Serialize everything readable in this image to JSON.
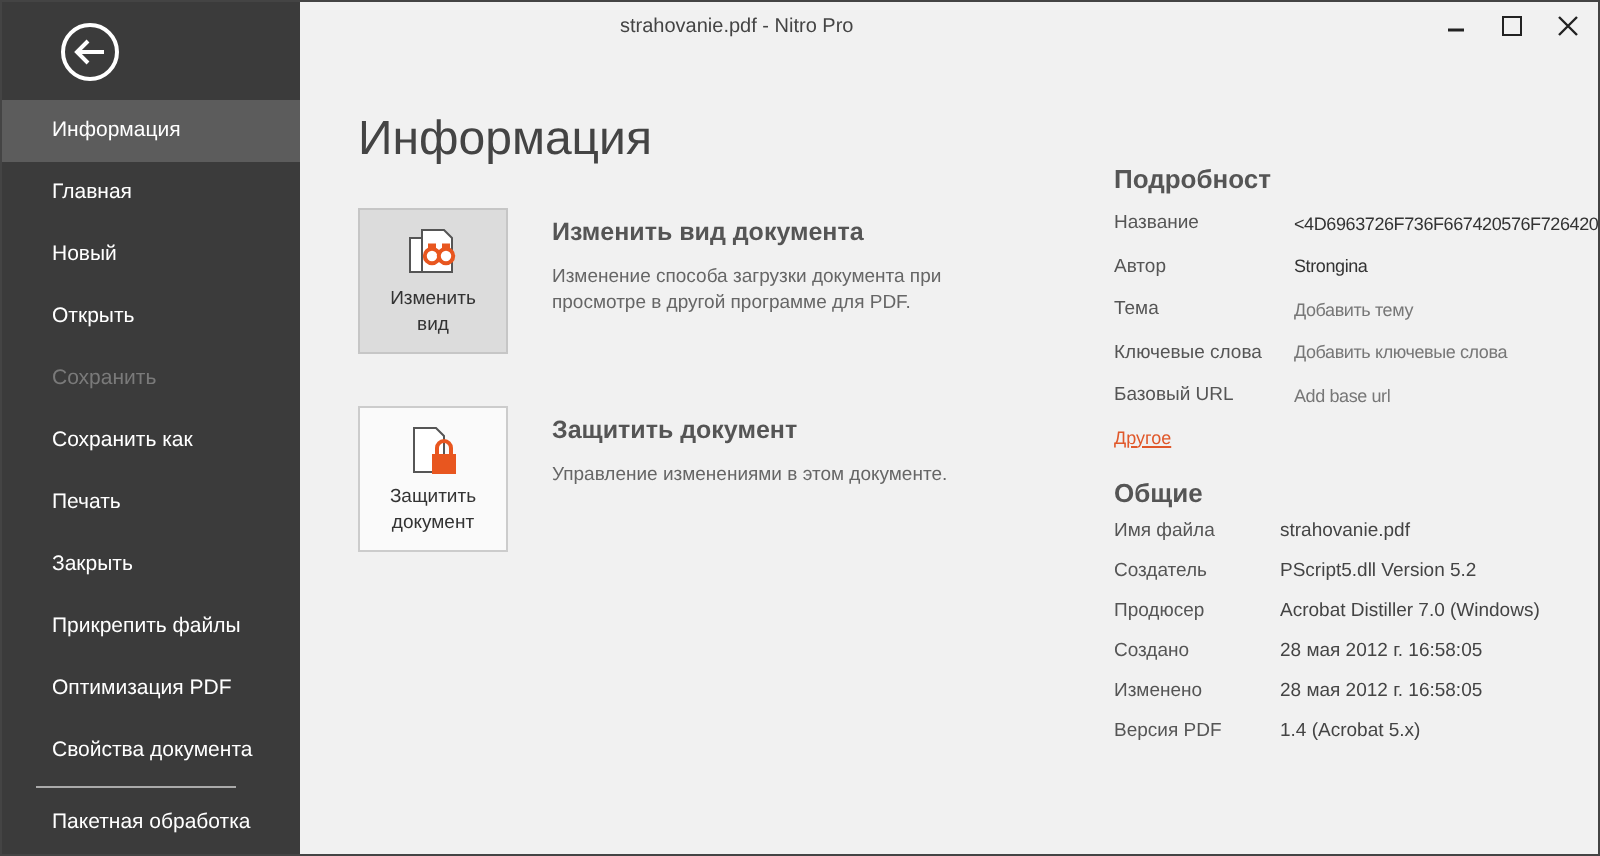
{
  "window": {
    "title": "strahovanie.pdf - Nitro Pro"
  },
  "sidebar": {
    "items": [
      {
        "label": "Информация",
        "selected": true,
        "disabled": false
      },
      {
        "label": "Главная",
        "selected": false,
        "disabled": false
      },
      {
        "label": "Новый",
        "selected": false,
        "disabled": false
      },
      {
        "label": "Открыть",
        "selected": false,
        "disabled": false
      },
      {
        "label": "Сохранить",
        "selected": false,
        "disabled": true
      },
      {
        "label": "Сохранить как",
        "selected": false,
        "disabled": false
      },
      {
        "label": "Печать",
        "selected": false,
        "disabled": false
      },
      {
        "label": "Закрыть",
        "selected": false,
        "disabled": false
      },
      {
        "label": "Прикрепить файлы",
        "selected": false,
        "disabled": false
      },
      {
        "label": "Оптимизация PDF",
        "selected": false,
        "disabled": false
      },
      {
        "label": "Свойства документа",
        "selected": false,
        "disabled": false
      }
    ],
    "footer_item": {
      "label": "Пакетная обработка",
      "selected": false,
      "disabled": false
    }
  },
  "page_title": "Информация",
  "actions": [
    {
      "kind": "view",
      "button": [
        "Изменить",
        "вид"
      ],
      "selected": true,
      "title": "Изменить вид документа",
      "description": "Изменение способа загрузки документа при просмотре в другой программе для PDF."
    },
    {
      "kind": "protect",
      "button": [
        "Защитить",
        "документ"
      ],
      "selected": false,
      "title": "Защитить документ",
      "description": "Управление изменениями в этом документе."
    }
  ],
  "details": {
    "heading": "Подробност",
    "rows": [
      {
        "label": "Название",
        "value": "<4D6963726F736F667420576F726420"
      },
      {
        "label": "Автор",
        "value": "Strongina"
      },
      {
        "label": "Тема",
        "placeholder": "Добавить тему"
      },
      {
        "label": "Ключевые слова",
        "placeholder": "Добавить ключевые слова"
      },
      {
        "label": "Базовый URL",
        "placeholder": "Add base url"
      }
    ],
    "link": "Другое"
  },
  "general": {
    "heading": "Общие",
    "rows": [
      {
        "label": "Имя файла",
        "value": "strahovanie.pdf"
      },
      {
        "label": "Создатель",
        "value": "PScript5.dll Version 5.2"
      },
      {
        "label": "Продюсер",
        "value": "Acrobat Distiller 7.0 (Windows)"
      },
      {
        "label": "Создано",
        "value": "28 мая 2012 г. 16:58:05"
      },
      {
        "label": "Изменено",
        "value": "28 мая 2012 г. 16:58:05"
      },
      {
        "label": "Версия PDF",
        "value": "1.4 (Acrobat 5.x)"
      }
    ]
  }
}
